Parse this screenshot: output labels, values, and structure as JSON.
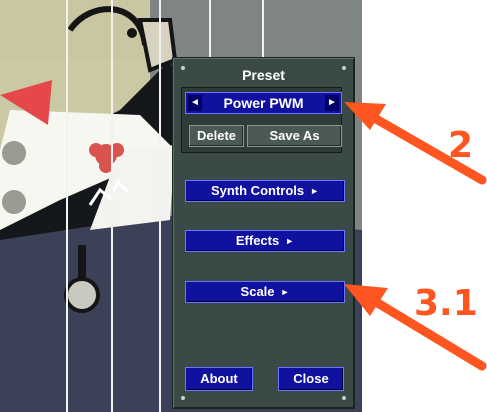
{
  "panel": {
    "title": "Preset",
    "preset_name": "Power PWM",
    "prev_arrow": "◄",
    "next_arrow": "►",
    "delete_label": "Delete",
    "save_as_label": "Save As",
    "synth_controls_label": "Synth Controls",
    "effects_label": "Effects",
    "scale_label": "Scale",
    "submenu_arrow": "►",
    "about_label": "About",
    "close_label": "Close"
  },
  "annotations": {
    "label_preset_arrow": "2",
    "label_scale_arrow": "3.1",
    "color": "#ff5520"
  },
  "colors": {
    "panel_bg": "#3a4a47",
    "button_blue": "#1111a0",
    "button_border": "#6a78ff"
  },
  "icons": {
    "prev": "left-triangle-icon",
    "next": "right-triangle-icon",
    "submenu": "right-triangle-icon"
  }
}
